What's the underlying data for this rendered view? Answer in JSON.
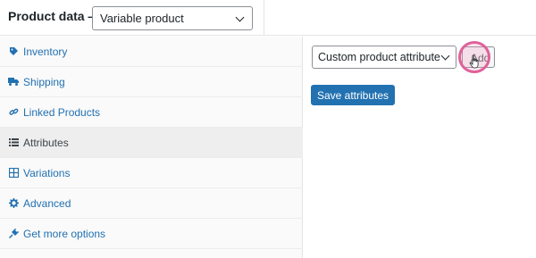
{
  "header": {
    "label": "Product data —",
    "product_type": "Variable product"
  },
  "sidebar": {
    "items": [
      {
        "label": "Inventory",
        "icon": "tag-icon",
        "active": false
      },
      {
        "label": "Shipping",
        "icon": "truck-icon",
        "active": false
      },
      {
        "label": "Linked Products",
        "icon": "link-icon",
        "active": false
      },
      {
        "label": "Attributes",
        "icon": "list-icon",
        "active": true
      },
      {
        "label": "Variations",
        "icon": "grid-icon",
        "active": false
      },
      {
        "label": "Advanced",
        "icon": "gear-icon",
        "active": false
      },
      {
        "label": "Get more options",
        "icon": "plug-icon",
        "active": false
      }
    ]
  },
  "main": {
    "attribute_select": "Custom product attribute",
    "add_label": "Add",
    "save_label": "Save attributes"
  },
  "colors": {
    "link": "#2271b1",
    "primary_button": "#2271b1",
    "active_tab_bg": "#eeeeee",
    "highlight": "#e0609a"
  }
}
